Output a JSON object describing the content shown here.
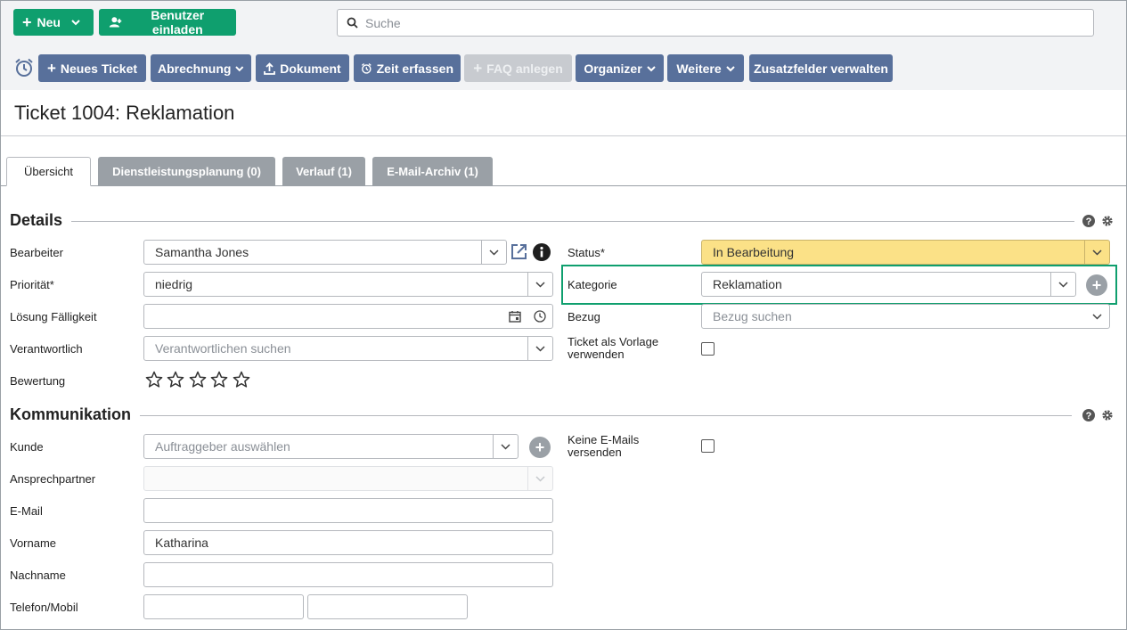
{
  "header": {
    "new_button": "Neu",
    "invite_button": "Benutzer einladen",
    "search_placeholder": "Suche"
  },
  "toolbar": {
    "new_ticket": "Neues Ticket",
    "billing": "Abrechnung",
    "document": "Dokument",
    "time": "Zeit erfassen",
    "faq": "FAQ anlegen",
    "organizer": "Organizer",
    "more": "Weitere",
    "custom_fields": "Zusatzfelder verwalten"
  },
  "page": {
    "title": "Ticket 1004: Reklamation"
  },
  "tabs": [
    {
      "label": "Übersicht"
    },
    {
      "label": "Dienstleistungsplanung (0)"
    },
    {
      "label": "Verlauf (1)"
    },
    {
      "label": "E-Mail-Archiv (1)"
    }
  ],
  "details": {
    "title": "Details",
    "assignee_label": "Bearbeiter",
    "assignee_value": "Samantha Jones",
    "priority_label": "Priorität*",
    "priority_value": "niedrig",
    "due_label": "Lösung Fälligkeit",
    "responsible_label": "Verantwortlich",
    "responsible_placeholder": "Verantwortlichen suchen",
    "rating_label": "Bewertung",
    "rating_stars": 0,
    "status_label": "Status*",
    "status_value": "In Bearbeitung",
    "status_color": "#fbe187",
    "category_label": "Kategorie",
    "category_value": "Reklamation",
    "reference_label": "Bezug",
    "reference_placeholder": "Bezug suchen",
    "template_label_1": "Ticket als Vorlage",
    "template_label_2": "verwenden"
  },
  "communication": {
    "title": "Kommunikation",
    "customer_label": "Kunde",
    "customer_placeholder": "Auftraggeber auswählen",
    "contact_label": "Ansprechpartner",
    "email_label": "E-Mail",
    "firstname_label": "Vorname",
    "firstname_value": "Katharina",
    "lastname_label": "Nachname",
    "phone_label": "Telefon/Mobil",
    "no_email_label_1": "Keine E-Mails",
    "no_email_label_2": "versenden"
  },
  "colors": {
    "green": "#0f9f6e",
    "toolbar_blue": "#58709b",
    "highlight": "#0f9f6e"
  }
}
